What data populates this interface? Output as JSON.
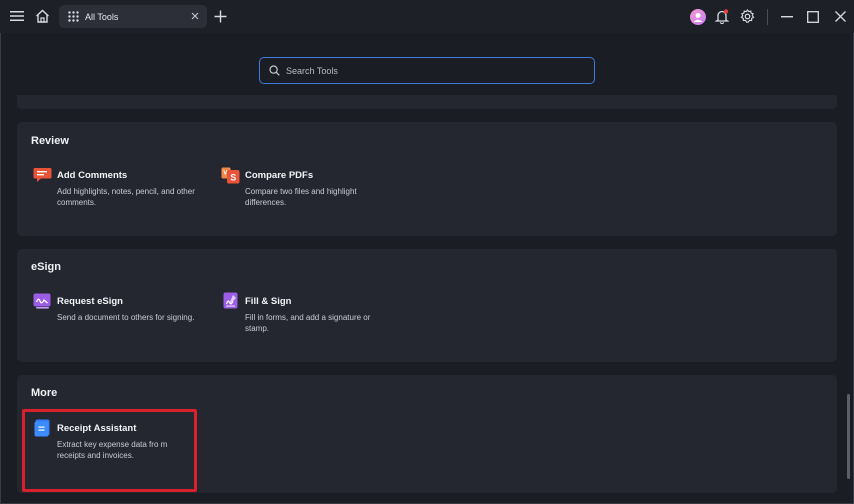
{
  "tab": {
    "label": "All Tools"
  },
  "search": {
    "placeholder": "Search Tools"
  },
  "sections": {
    "review": {
      "title": "Review",
      "tools": [
        {
          "name": "Add Comments",
          "desc": "Add highlights, notes, pencil, and other comments."
        },
        {
          "name": "Compare PDFs",
          "desc": "Compare two files and highlight differences."
        }
      ]
    },
    "esign": {
      "title": "eSign",
      "tools": [
        {
          "name": "Request eSign",
          "desc": "Send a document to others for signing."
        },
        {
          "name": "Fill & Sign",
          "desc": "Fill in forms, and add a signature or stamp."
        }
      ]
    },
    "more": {
      "title": "More",
      "tools": [
        {
          "name": "Receipt Assistant",
          "desc": "Extract key expense data fro m receipts and invoices."
        }
      ]
    }
  },
  "colors": {
    "accent": "#3f7bd6",
    "highlight": "#d9202b",
    "comments_icon": "#e8533a",
    "compare_icon": "#e8533a",
    "esign_icon": "#9b5de5",
    "receipt_icon": "#2f7cf6"
  }
}
